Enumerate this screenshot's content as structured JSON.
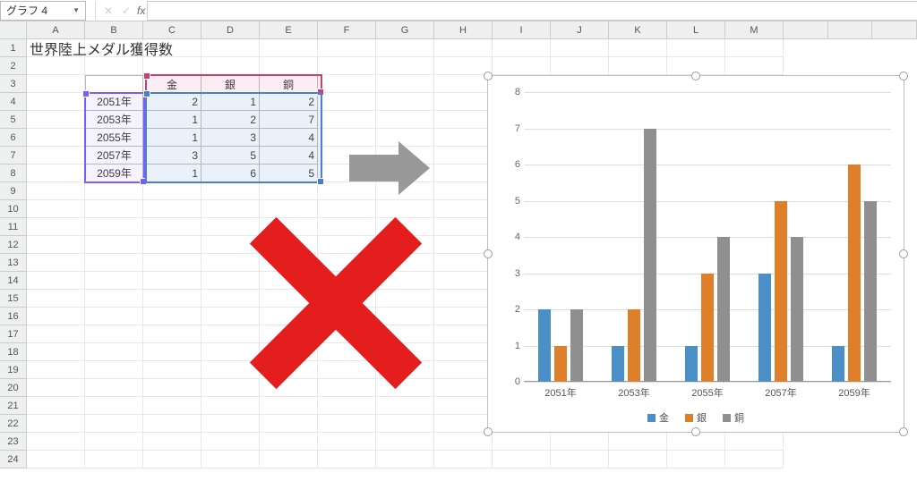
{
  "namebox": "グラフ 4",
  "fx_label": "fx",
  "columns": [
    "A",
    "B",
    "C",
    "D",
    "E",
    "F",
    "G",
    "H",
    "I",
    "J",
    "K",
    "L",
    "M"
  ],
  "row_count": 24,
  "sheet": {
    "title": "世界陸上メダル獲得数",
    "headers": {
      "c": "金",
      "d": "銀",
      "e": "銅"
    },
    "rows": [
      {
        "year": "2051年",
        "c": "2",
        "d": "1",
        "e": "2"
      },
      {
        "year": "2053年",
        "c": "1",
        "d": "2",
        "e": "7"
      },
      {
        "year": "2055年",
        "c": "1",
        "d": "3",
        "e": "4"
      },
      {
        "year": "2057年",
        "c": "3",
        "d": "5",
        "e": "4"
      },
      {
        "year": "2059年",
        "c": "1",
        "d": "6",
        "e": "5"
      }
    ]
  },
  "chart_data": {
    "type": "bar",
    "categories": [
      "2051年",
      "2053年",
      "2055年",
      "2057年",
      "2059年"
    ],
    "series": [
      {
        "name": "金",
        "color": "#4a8fc8",
        "values": [
          2,
          1,
          1,
          3,
          1
        ]
      },
      {
        "name": "銀",
        "color": "#e07f2a",
        "values": [
          1,
          2,
          3,
          5,
          6
        ]
      },
      {
        "name": "銅",
        "color": "#8f8f8f",
        "values": [
          2,
          7,
          4,
          4,
          5
        ]
      }
    ],
    "ylim": [
      0,
      8
    ],
    "yticks": [
      0,
      1,
      2,
      3,
      4,
      5,
      6,
      7,
      8
    ]
  }
}
